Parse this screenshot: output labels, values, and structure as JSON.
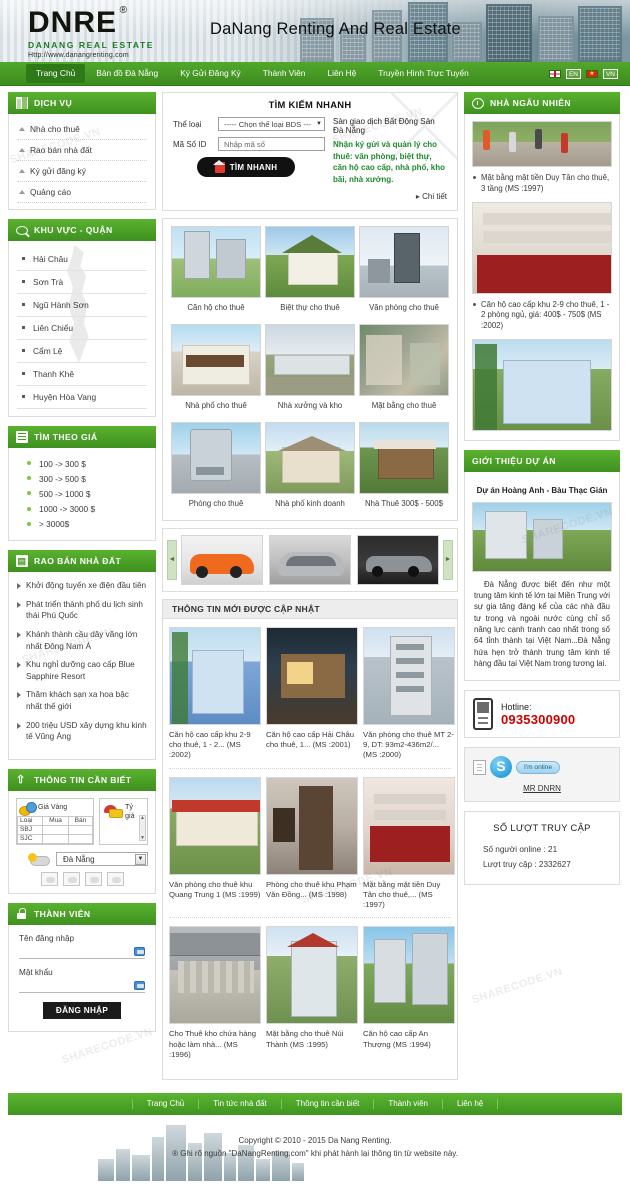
{
  "header": {
    "logo_main": "DNRE",
    "logo_reg": "®",
    "logo_sub": "DANANG REAL ESTATE",
    "logo_url": "Http://www.danangrenting.com",
    "title": "DaNang Renting And Real Estate"
  },
  "nav": {
    "items": [
      {
        "label": "Trang Chủ",
        "active": true
      },
      {
        "label": "Bản đồ Đà Nẵng",
        "active": false
      },
      {
        "label": "Ký Gửi Đăng Ký",
        "active": false
      },
      {
        "label": "Thành Viên",
        "active": false
      },
      {
        "label": "Liên Hệ",
        "active": false
      },
      {
        "label": "Truyền Hình Trực Tuyến",
        "active": false
      }
    ],
    "lang_en": "EN",
    "lang_vn": "VN"
  },
  "sidebar_left": {
    "services": {
      "title": "DỊCH VỤ",
      "items": [
        "Nhà cho thuê",
        "Rao bán nhà đất",
        "Ký gửi đăng ký",
        "Quảng cáo"
      ]
    },
    "areas": {
      "title": "KHU VỰC - QUẬN",
      "items": [
        "Hải Châu",
        "Sơn Trà",
        "Ngũ Hành Sơn",
        "Liên Chiểu",
        "Cẩm Lệ",
        "Thanh Khê",
        "Huyện Hòa Vang"
      ]
    },
    "price": {
      "title": "TÌM THEO GIÁ",
      "items": [
        "100    -> 300 $",
        "300    -> 500 $",
        "500    -> 1000 $",
        "1000   -> 3000 $",
        "> 3000$"
      ]
    },
    "news": {
      "title": "RAO BÁN NHÀ ĐẤT",
      "items": [
        "Khởi động tuyến xe điện đầu tiên",
        "Phát triển thành phố du lịch sinh thái Phú Quốc",
        "Khánh thành cầu dây văng lớn nhất Đông Nam Á",
        "Khu nghỉ dưỡng cao cấp Blue Sapphire Resort",
        "Thăm khách sạn xa hoa bậc nhất thế giới",
        "200 triệu USD xây dựng khu kinh tế Vũng Áng"
      ]
    },
    "info": {
      "title": "THÔNG TIN CẦN BIẾT",
      "gold_label": "Giá Vàng",
      "rate_label": "Tỷ giá",
      "gold_headers": [
        "Loại",
        "Mua",
        "Bán"
      ],
      "gold_rows": [
        {
          "type": "SBJ",
          "buy": "",
          "sell": ""
        },
        {
          "type": "SJC",
          "buy": "",
          "sell": ""
        }
      ],
      "city_selected": "Đà Nẵng"
    },
    "member": {
      "title": "THÀNH VIÊN",
      "username_label": "Tên đăng nhập",
      "password_label": "Mật khẩu",
      "username_value": "",
      "password_value": "",
      "login_button": "ĐĂNG NHẬP"
    }
  },
  "search": {
    "title": "TÌM KIẾM NHANH",
    "type_label": "Thể loại",
    "type_selected": "----- Chọn thể loại BDS ---",
    "id_label": "Mã Số ID",
    "id_placeholder": "Nhập mã số",
    "button": "TÌM NHANH",
    "promo_line1": "Sàn giao dịch Bất Động Sản Đà Nẵng",
    "promo_line2": "Nhận ký gửi và quản lý cho thuê: văn phòng, biệt thự, căn hộ cao cấp, nhà phố, kho bãi, nhà xưởng.",
    "detail_link": "Chi tiết"
  },
  "categories": [
    {
      "label": "Căn hộ cho thuê",
      "art": "t-apart"
    },
    {
      "label": "Biệt thự cho thuê",
      "art": "t-villa"
    },
    {
      "label": "Văn phòng cho thuê",
      "art": "t-office"
    },
    {
      "label": "Nhà phố cho thuê",
      "art": "t-shop"
    },
    {
      "label": "Nhà xưởng và kho",
      "art": "t-ware"
    },
    {
      "label": "Mặt bằng cho thuê",
      "art": "t-land"
    },
    {
      "label": "Phòng cho thuê",
      "art": "t-room"
    },
    {
      "label": "Nhà phố kinh doanh",
      "art": "t-town"
    },
    {
      "label": "Nhà Thuê 300$ - 500$",
      "art": "t-modern"
    }
  ],
  "car_banner": {
    "prev": "◄",
    "next": "►",
    "items": [
      "c-orange",
      "c-silver",
      "c-dark"
    ]
  },
  "latest": {
    "title": "THÔNG TIN MỚI ĐƯỢC CẬP NHẬT",
    "items": [
      {
        "caption": "Căn hộ cao cấp khu 2-9 cho thuê, 1 - 2... (MS :2002)",
        "art": "lc-1"
      },
      {
        "caption": "Căn hộ cao cấp Hải Châu cho thuê, 1... (MS :2001)",
        "art": "lc-2"
      },
      {
        "caption": "Văn phòng cho thuê MT 2-9, DT: 93m2-436m2/... (MS :2000)",
        "art": "lc-3"
      },
      {
        "caption": "Văn phòng cho thuê khu Quang Trung 1 (MS :1999)",
        "art": "lc-4"
      },
      {
        "caption": "Phòng cho thuê khu Phạm Văn Đồng... (MS :1998)",
        "art": "lc-5"
      },
      {
        "caption": "Mặt bằng mặt tiền Duy Tân cho thuê,... (MS :1997)",
        "art": "lc-6"
      },
      {
        "caption": "Cho Thuê kho chứa hàng hoặc làm nhà... (MS :1996)",
        "art": "lc-7"
      },
      {
        "caption": "Mặt bằng cho thuê Núi Thành (MS :1995)",
        "art": "lc-8"
      },
      {
        "caption": "Căn hộ cao cấp An Thượng (MS :1994)",
        "art": "lc-9"
      }
    ]
  },
  "sidebar_right": {
    "random": {
      "title": "NHÀ NGẪU NHIÊN",
      "items": [
        {
          "caption": "Mặt bằng mặt tiền Duy Tân cho thuê, 3 tầng (MS :1997)",
          "art": "ri-street"
        },
        {
          "caption": "Căn hộ cao cấp khu 2-9 cho thuê, 1 - 2 phòng ngủ, giá: 400$ - 750$ (MS :2002)",
          "art": "ri-shop"
        }
      ],
      "extra_art": "ri-house"
    },
    "project": {
      "title": "GIỚI THIỆU DỰ ÁN",
      "name": "Dự án Hoàng Anh - Bàu Thạc Gián",
      "text": "Đà Nẵng được biết đến như một trung tâm kinh tế lớn tại Miền Trung với sự gia tăng đáng kể của các nhà đầu tư trong và ngoài nước cùng chỉ số năng lực cạnh tranh cao nhất trong số 64 tỉnh thành tại Việt Nam...Đà Nẵng hứa hẹn trở thành trung tâm kinh tế hàng đầu tại Việt Nam trong tương lai."
    },
    "hotline": {
      "label": "Hotline:",
      "number": "0935300900"
    },
    "skype": {
      "status": "I'm online",
      "name": "MR DNRN"
    },
    "visits": {
      "title": "SỐ LƯỢT TRUY CẬP",
      "online_label": "Số người online : 21",
      "total_label": "Lượt truy cập : 2332627"
    }
  },
  "footer": {
    "links": [
      "Trang Chủ",
      "Tin tức nhà đất",
      "Thông tin cần biết",
      "Thành viên",
      "Liên hệ"
    ],
    "copyright_line1": "Copyright © 2010 - 2015 Da Nang Renting.",
    "copyright_line2": "® Ghi rõ nguồn \"DaNangRenting.com\" khi phát hành lại thông tin từ website này."
  }
}
